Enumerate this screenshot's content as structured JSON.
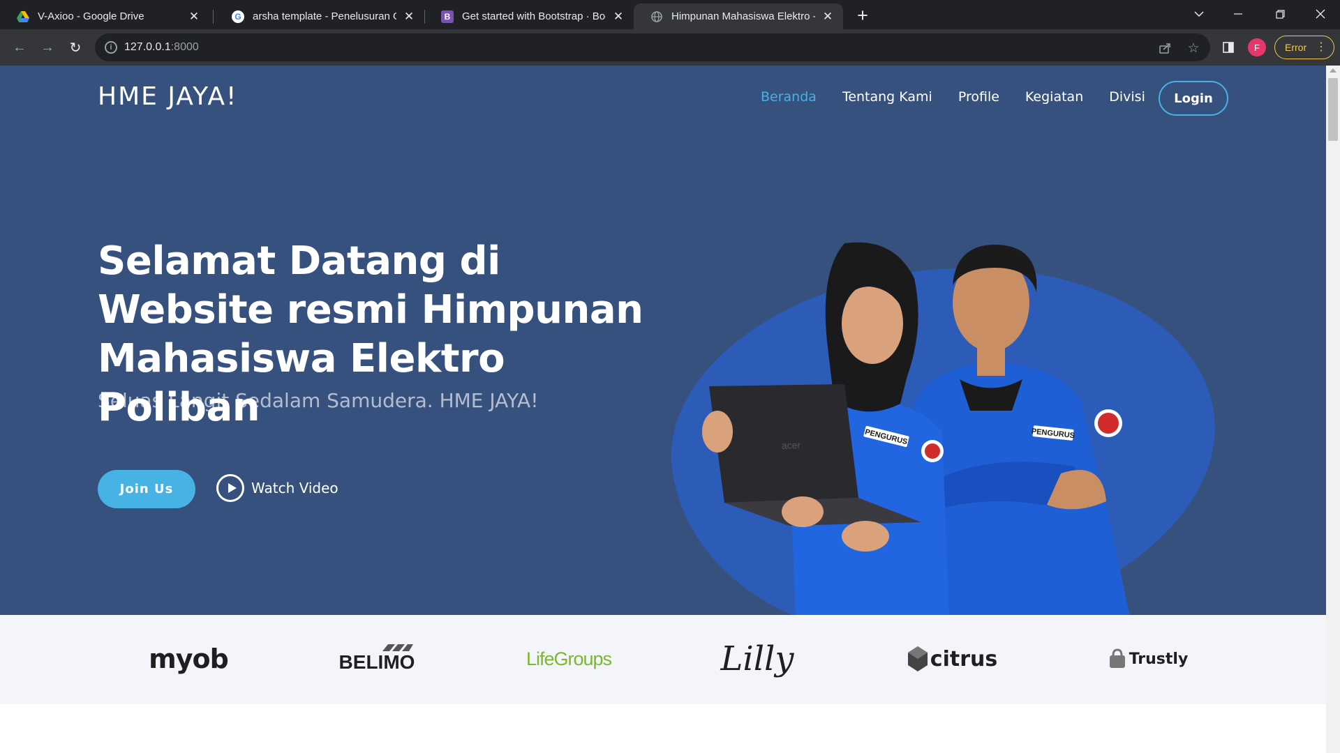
{
  "browser": {
    "tabs": [
      {
        "title": "V-Axioo - Google Drive",
        "icon": "google-drive-icon"
      },
      {
        "title": "arsha template - Penelusuran Go",
        "icon": "google-icon"
      },
      {
        "title": "Get started with Bootstrap · Boot",
        "icon": "bootstrap-icon"
      },
      {
        "title": "Himpunan Mahasiswa Elektro - P",
        "icon": "globe-icon"
      }
    ],
    "url_host": "127.0.0.1",
    "url_port": ":8000",
    "profile_initial": "F",
    "error_label": "Error"
  },
  "site": {
    "logo": "HME JAYA!",
    "nav": [
      "Beranda",
      "Tentang Kami",
      "Profile",
      "Kegiatan",
      "Divisi"
    ],
    "login": "Login"
  },
  "hero": {
    "title": "Selamat Datang di Website resmi Himpunan Mahasiswa Elektro Poliban",
    "subtitle": "Seluas Langit Sedalam Samudera. HME JAYA!",
    "join_label": "Join Us",
    "watch_label": "Watch Video",
    "badge_left": "PENGURUS",
    "badge_right": "PENGURUS",
    "laptop_brand": "acer"
  },
  "clients": [
    "myob",
    "BELIMO",
    "LifeGroups",
    "Lilly",
    "citrus",
    "Trustly"
  ],
  "colors": {
    "hero_bg": "#37517e",
    "accent": "#47b2e4",
    "blob": "#2d5bb8",
    "clients_bg": "#f3f5fa"
  }
}
